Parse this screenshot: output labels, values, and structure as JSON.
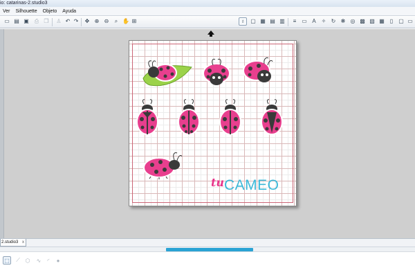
{
  "window": {
    "title": "io: catarinas-2.studio3"
  },
  "menu": {
    "items": [
      "Ver",
      "Silhouette",
      "Objeto",
      "Ayuda"
    ]
  },
  "toolbar": {
    "left_icons": [
      "page-icon",
      "open-icon",
      "save-icon",
      "print-icon",
      "cut-icon",
      "copy-icon",
      "paste-icon",
      "person-icon",
      "undo-icon",
      "redo-icon",
      "pan-icon",
      "zoom-in-icon",
      "zoom-out-icon",
      "zoom-fit-icon",
      "hand-icon",
      "grid-icon"
    ],
    "right_icons": [
      "cameo-settings-icon",
      "design-page-icon",
      "grid-settings-icon",
      "align-icon",
      "replicate-icon",
      "text-style-icon",
      "text-icon",
      "modify-icon",
      "transform-icon",
      "offset-icon",
      "trace-icon",
      "fill-color-icon",
      "line-color-icon",
      "line-style-icon",
      "fill-pattern-icon",
      "library-icon",
      "store-icon",
      "cut-settings-icon",
      "send-icon"
    ]
  },
  "canvas": {
    "background": "#cfcfcf",
    "mat_border_color": "#cc6677",
    "ladybug_colors": {
      "shell": "#e83f8e",
      "spots": "#3a3a3a",
      "head": "#3a3a3a",
      "leaf": "#9bd24a"
    },
    "watermark": {
      "prefix": "tu",
      "brand": "CAMEO"
    }
  },
  "document_tab": {
    "label": "2.studio3",
    "close_glyph": "x"
  },
  "scrollbar": {
    "thumb_color": "#2aa3d4"
  },
  "bottom_tools": [
    "pointer-icon",
    "line-icon",
    "polygon-icon",
    "curve-icon",
    "arc-icon",
    "circle-icon"
  ]
}
